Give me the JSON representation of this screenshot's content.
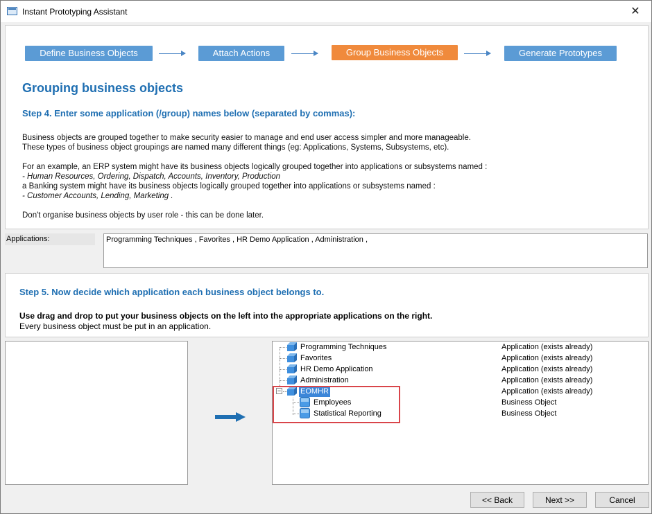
{
  "window": {
    "title": "Instant Prototyping Assistant",
    "close_glyph": "✕"
  },
  "steps": [
    {
      "label": "Define Business Objects",
      "active": false
    },
    {
      "label": "Attach Actions",
      "active": false
    },
    {
      "label": "Group Business Objects",
      "active": true
    },
    {
      "label": "Generate Prototypes",
      "active": false
    }
  ],
  "colors": {
    "step": "#5b9bd5",
    "step_active": "#f08a3c",
    "heading": "#1f6fb2",
    "highlight": "#d9454a",
    "selection": "#3c86d8"
  },
  "intro": {
    "heading": "Grouping business objects",
    "step4": "Step 4. Enter some application (/group) names below (separated by commas):",
    "p1": "Business objects are grouped together to make security easier to manage and end user access simpler and more manageable.",
    "p2": "These types of business object groupings are named many different things (eg: Applications, Systems, Subsystems, etc).",
    "p3": "For an example, an ERP system might have its business objects logically grouped together into applications or subsystems named :",
    "p4": "- Human Resources, Ordering, Dispatch, Accounts, Inventory, Production",
    "p5": "a Banking system might have its business objects logically grouped together into applications or subsystems named :",
    "p6": "- Customer Accounts, Lending, Marketing .",
    "p7": "Don't organise business objects by user role - this can be done later."
  },
  "applications": {
    "label": "Applications:",
    "value": "Programming Techniques , Favorites , HR Demo Application , Administration ,"
  },
  "step5": {
    "heading": "Step 5. Now decide which application each business object belongs to.",
    "drag": "Use drag and drop to put your business objects on the left into the appropriate applications on the right.",
    "must": "Every business object must be put in an application."
  },
  "tree": {
    "items": [
      {
        "label": "Programming Techniques",
        "kind": "Application (exists already)",
        "level": 0
      },
      {
        "label": "Favorites",
        "kind": "Application (exists already)",
        "level": 0
      },
      {
        "label": "HR Demo Application",
        "kind": "Application (exists already)",
        "level": 0
      },
      {
        "label": "Administration",
        "kind": "Application (exists already)",
        "level": 0
      },
      {
        "label": "EOMHR",
        "kind": "Application (exists already)",
        "level": 0,
        "selected": true,
        "expander": "−"
      },
      {
        "label": "Employees",
        "kind": "Business Object",
        "level": 1
      },
      {
        "label": "Statistical Reporting",
        "kind": "Business Object",
        "level": 1
      }
    ]
  },
  "buttons": {
    "back": "<< Back",
    "next": "Next >>",
    "cancel": "Cancel"
  }
}
